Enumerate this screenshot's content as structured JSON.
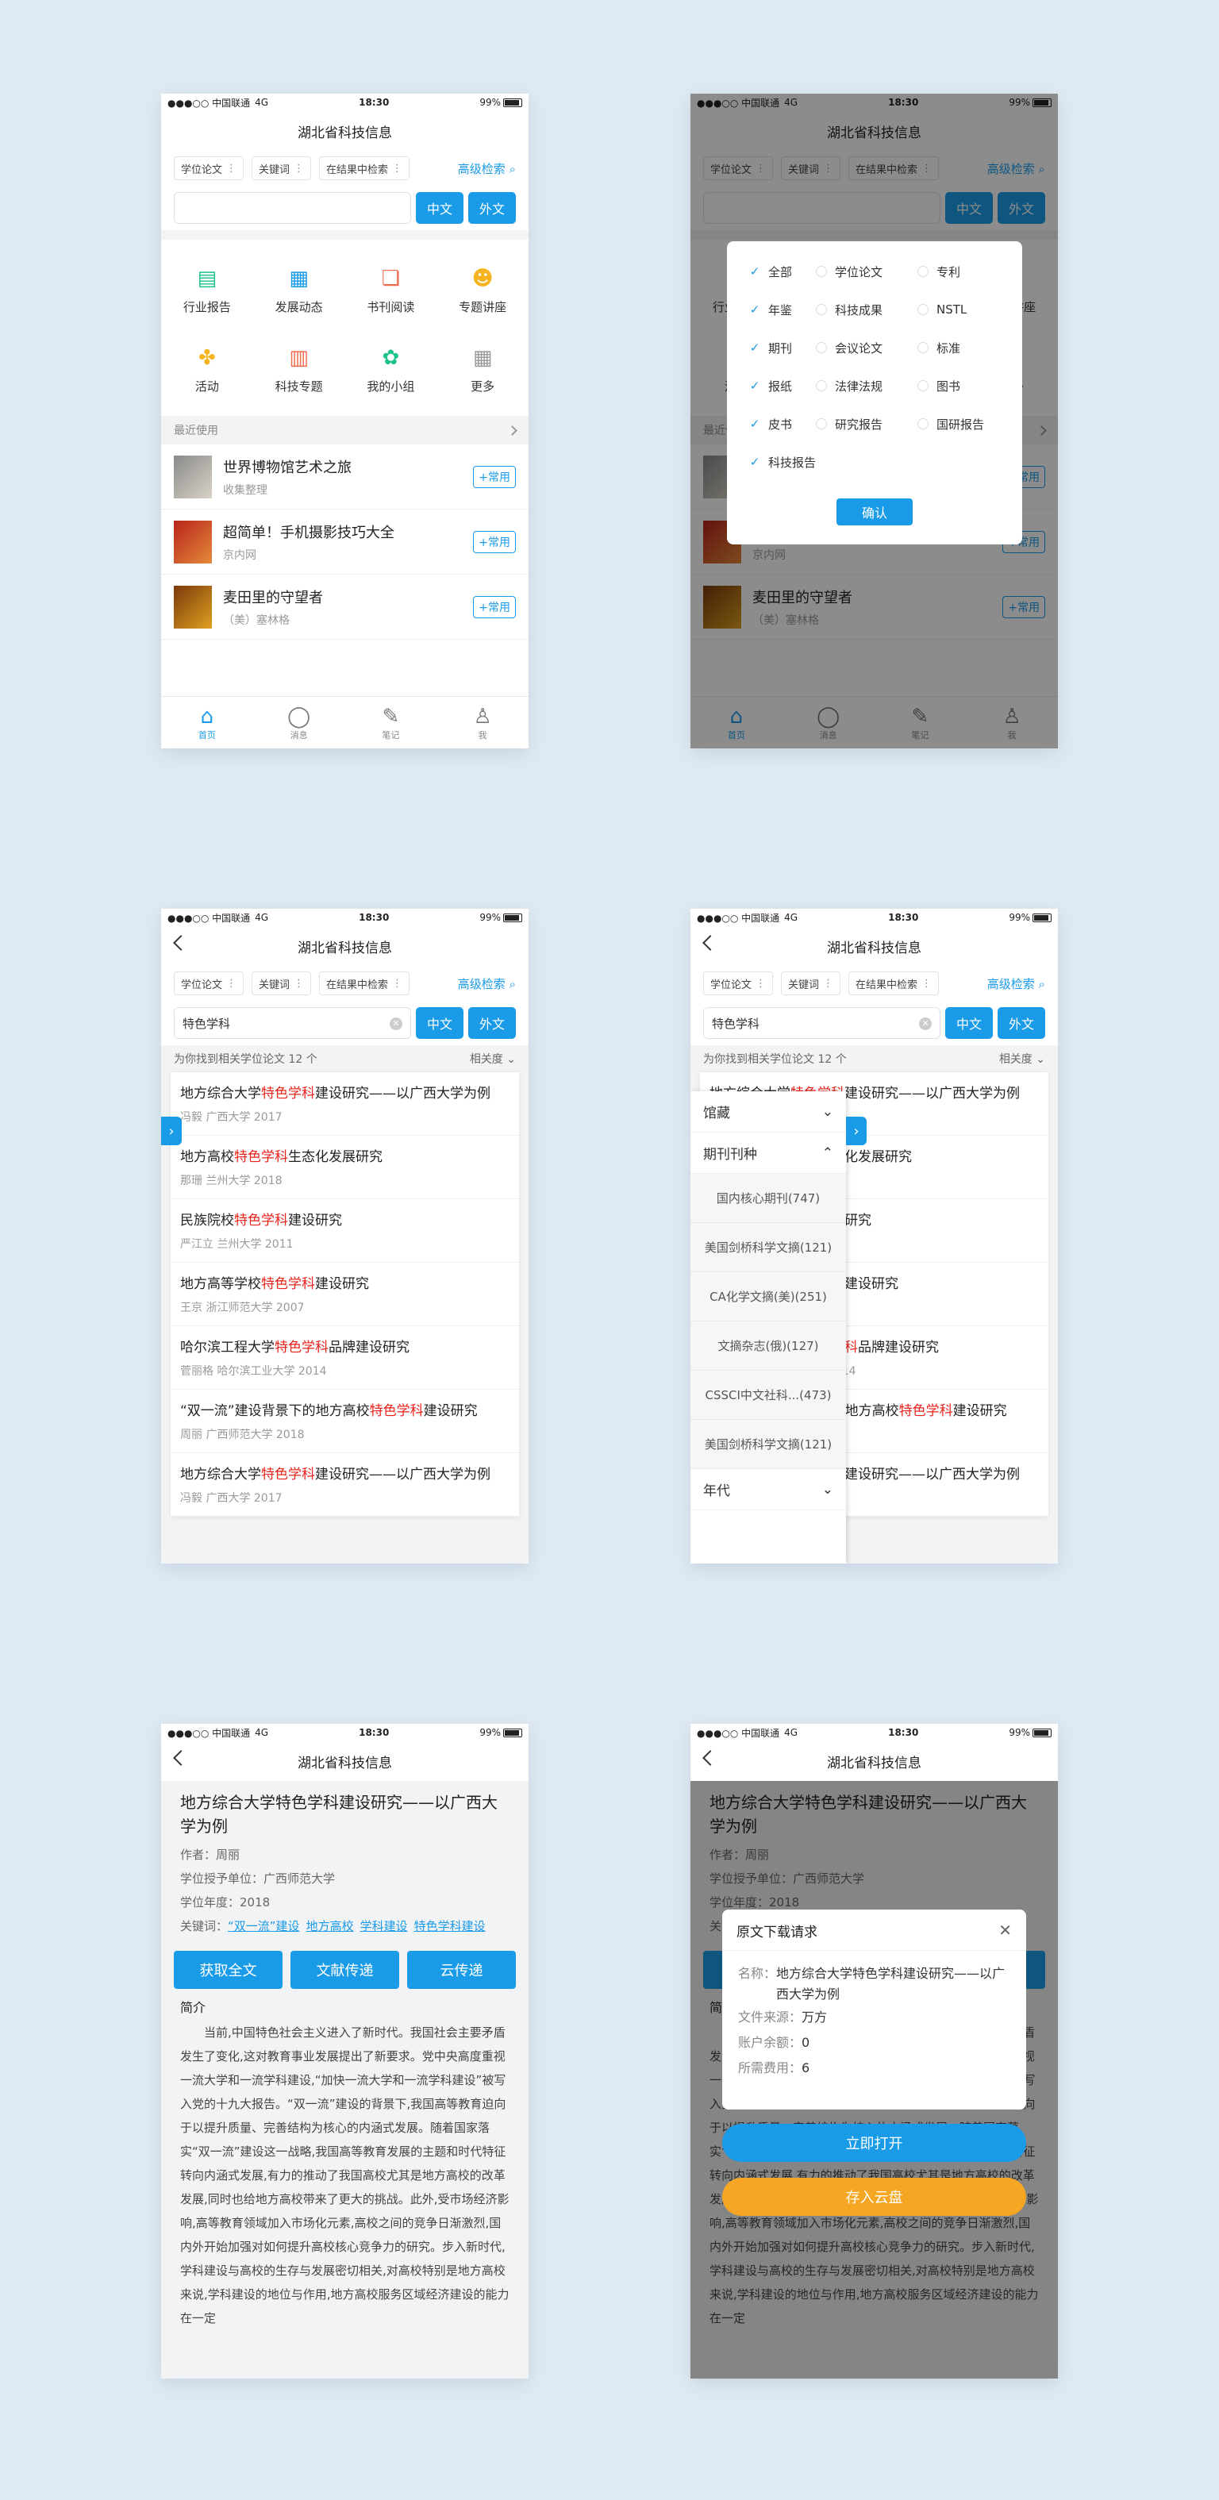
{
  "status": {
    "carrier": "●●●○○ 中国联通",
    "net": "4G",
    "time": "18:30",
    "battery": "99%"
  },
  "app_title": "湖北省科技信息",
  "filters": {
    "type": "学位论文",
    "field": "关键词",
    "scope": "在结果中检索",
    "advanced": "高级检索"
  },
  "search": {
    "query": "特色学科",
    "cn_btn": "中文",
    "en_btn": "外文"
  },
  "home": {
    "grid": [
      {
        "label": "行业报告",
        "icon": "report-icon",
        "glyph": "▤",
        "color": "#1cc28b"
      },
      {
        "label": "发展动态",
        "icon": "news-icon",
        "glyph": "▦",
        "color": "#1a9be8"
      },
      {
        "label": "书刊阅读",
        "icon": "book-icon",
        "glyph": "❏",
        "color": "#f06a4e"
      },
      {
        "label": "专题讲座",
        "icon": "lecture-icon",
        "glyph": "☻",
        "color": "#f5b420"
      },
      {
        "label": "活动",
        "icon": "pinwheel-icon",
        "glyph": "✤",
        "color": "#f5b420"
      },
      {
        "label": "科技专题",
        "icon": "topic-icon",
        "glyph": "▥",
        "color": "#f06a4e"
      },
      {
        "label": "我的小组",
        "icon": "group-icon",
        "glyph": "✿",
        "color": "#1cc28b"
      },
      {
        "label": "更多",
        "icon": "more-icon",
        "glyph": "▦",
        "color": "#999999"
      }
    ],
    "recent_label": "最近使用",
    "recent": [
      {
        "title": "世界博物馆艺术之旅",
        "sub": "收集整理",
        "btn": "+常用"
      },
      {
        "title": "超简单！手机摄影技巧大全",
        "sub": "京内网",
        "btn": "+常用"
      },
      {
        "title": "麦田里的守望者",
        "sub": "（美）塞林格",
        "btn": "+常用"
      }
    ]
  },
  "tabs": [
    {
      "label": "首页",
      "icon": "home-icon",
      "glyph": "⌂"
    },
    {
      "label": "消息",
      "icon": "message-icon",
      "glyph": "◯"
    },
    {
      "label": "笔记",
      "icon": "note-icon",
      "glyph": "✎"
    },
    {
      "label": "我",
      "icon": "profile-icon",
      "glyph": "♙"
    }
  ],
  "type_dialog": {
    "options": [
      [
        "全部",
        true
      ],
      [
        "学位论文",
        false
      ],
      [
        "专利",
        false
      ],
      [
        "年鉴",
        true
      ],
      [
        "科技成果",
        false
      ],
      [
        "NSTL",
        false
      ],
      [
        "期刊",
        true
      ],
      [
        "会议论文",
        false
      ],
      [
        "标准",
        false
      ],
      [
        "报纸",
        true
      ],
      [
        "法律法规",
        false
      ],
      [
        "图书",
        false
      ],
      [
        "皮书",
        true
      ],
      [
        "研究报告",
        false
      ],
      [
        "国研报告",
        false
      ],
      [
        "科技报告",
        true
      ]
    ],
    "confirm": "确认"
  },
  "results": {
    "summary": "为你找到相关学位论文 12 个",
    "sort": "相关度",
    "items": [
      {
        "pre": "地方综合大学",
        "hl": "特色学科",
        "post": "建设研究——以广西大学为例",
        "meta": "冯毅   广西大学   2017"
      },
      {
        "pre": "地方高校",
        "hl": "特色学科",
        "post": "生态化发展研究",
        "meta": "那珊   兰州大学   2018"
      },
      {
        "pre": "民族院校",
        "hl": "特色学科",
        "post": "建设研究",
        "meta": "严江立   兰州大学   2011"
      },
      {
        "pre": "地方高等学校",
        "hl": "特色学科",
        "post": "建设研究",
        "meta": "王京   浙江师范大学   2007"
      },
      {
        "pre": "哈尔滨工程大学",
        "hl": "特色学科",
        "post": "品牌建设研究",
        "meta": "菅丽格   哈尔滨工业大学   2014"
      },
      {
        "pre": "“双一流”建设背景下的地方高校",
        "hl": "特色学科",
        "post": "建设研究",
        "meta": "周丽   广西师范大学   2018"
      },
      {
        "pre": "地方综合大学",
        "hl": "特色学科",
        "post": "建设研究——以广西大学为例",
        "meta": "冯毅   广西大学   2017"
      }
    ]
  },
  "facets": {
    "collection": "馆藏",
    "journal_type": "期刊刊种",
    "options": [
      "国内核心期刊(747)",
      "美国剑桥科学文摘(121)",
      "CA化学文摘(美)(251)",
      "文摘杂志(俄)(127)",
      "CSSCI中文社科...(473)",
      "美国剑桥科学文摘(121)"
    ],
    "year": "年代"
  },
  "detail": {
    "title": "地方综合大学特色学科建设研究——以广西大学为例",
    "author": "作者：周丽",
    "unit": "学位授予单位：广西师范大学",
    "year": "学位年度：2018",
    "kw_label": "关键词：",
    "keywords": [
      "“双一流”建设",
      "地方高校",
      "学科建设",
      "特色学科建设"
    ],
    "actions": [
      "获取全文",
      "文献传递",
      "云传递"
    ],
    "intro_label": "简介",
    "abstract": "当前,中国特色社会主义进入了新时代。我国社会主要矛盾发生了变化,这对教育事业发展提出了新要求。党中央高度重视一流大学和一流学科建设,“加快一流大学和一流学科建设”被写入党的十九大报告。“双一流”建设的背景下,我国高等教育迫向于以提升质量、完善结构为核心的内涵式发展。随着国家落实“双一流”建设这一战略,我国高等教育发展的主题和时代特征转向内涵式发展,有力的推动了我国高校尤其是地方高校的改革发展,同时也给地方高校带来了更大的挑战。此外,受市场经济影响,高等教育领域加入市场化元素,高校之间的竞争日渐激烈,国内外开始加强对如何提升高校核心竞争力的研究。步入新时代,学科建设与高校的生存与发展密切相关,对高校特别是地方高校来说,学科建设的地位与作用,地方高校服务区域经济建设的能力在一定"
  },
  "download": {
    "title": "原文下载请求",
    "name_label": "名称：",
    "name_value": "地方综合大学特色学科建设研究——以广西大学为例",
    "source_label": "文件来源：",
    "source_value": "万方",
    "balance_label": "账户余额：",
    "balance_value": "0",
    "fee_label": "所需费用：",
    "fee_value": "6",
    "open_btn": "立即打开",
    "cloud_btn": "存入云盘",
    "open_color": "#1a9be8",
    "cloud_color": "#f5a623"
  }
}
